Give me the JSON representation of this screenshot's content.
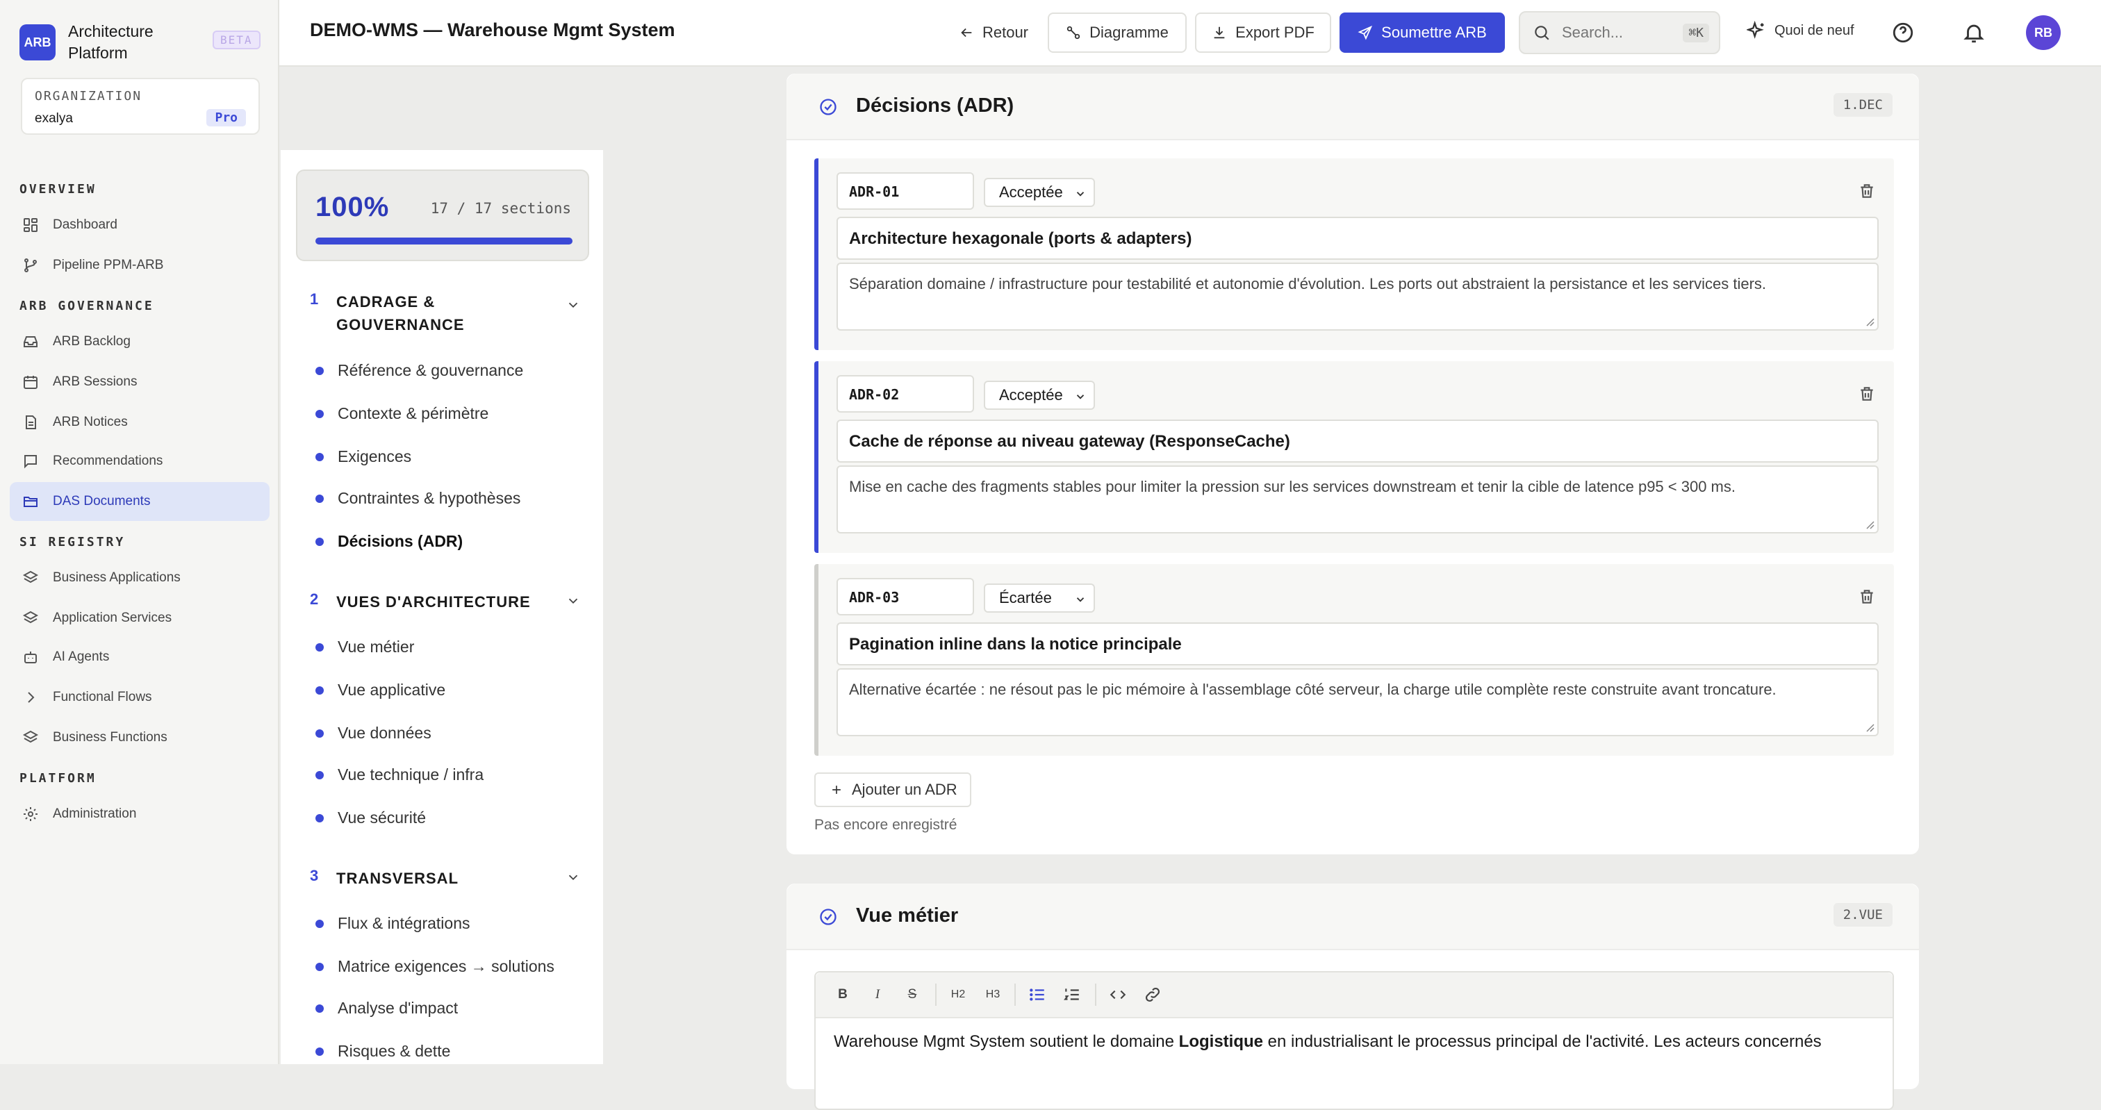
{
  "brand": {
    "logo": "ARB",
    "name": "Architecture Platform",
    "badge": "BETA"
  },
  "organization": {
    "label": "ORGANIZATION",
    "name": "exalya",
    "plan": "Pro"
  },
  "nav": {
    "overview_label": "OVERVIEW",
    "governance_label": "ARB GOVERNANCE",
    "registry_label": "SI REGISTRY",
    "platform_label": "PLATFORM",
    "items": [
      {
        "label": "Dashboard",
        "icon": "grid-icon"
      },
      {
        "label": "Pipeline PPM-ARB",
        "icon": "branch-icon"
      },
      {
        "label": "ARB Backlog",
        "icon": "inbox-icon"
      },
      {
        "label": "ARB Sessions",
        "icon": "calendar-icon"
      },
      {
        "label": "ARB Notices",
        "icon": "file-icon"
      },
      {
        "label": "Recommendations",
        "icon": "message-icon"
      },
      {
        "label": "DAS Documents",
        "icon": "folder-icon",
        "active": true
      },
      {
        "label": "Business Applications",
        "icon": "layers-icon"
      },
      {
        "label": "Application Services",
        "icon": "layers-icon"
      },
      {
        "label": "AI Agents",
        "icon": "bot-icon"
      },
      {
        "label": "Functional Flows",
        "icon": "chevron-right-icon"
      },
      {
        "label": "Business Functions",
        "icon": "layers-icon"
      },
      {
        "label": "Administration",
        "icon": "gear-icon"
      }
    ]
  },
  "header": {
    "title": "DEMO-WMS — Warehouse Mgmt System",
    "back": "Retour",
    "diagram": "Diagramme",
    "export": "Export PDF",
    "submit": "Soumettre ARB",
    "search_placeholder": "Search...",
    "search_shortcut": "⌘K",
    "whats_new": "Quoi de neuf",
    "avatar": "RB"
  },
  "toc": {
    "progress": "100%",
    "progress_value": 1.0,
    "progress_count": "17 / 17 sections",
    "groups": [
      {
        "num": "1",
        "title": "CADRAGE & GOUVERNANCE",
        "items": [
          "Référence & gouvernance",
          "Contexte & périmètre",
          "Exigences",
          "Contraintes & hypothèses",
          "Décisions (ADR)"
        ]
      },
      {
        "num": "2",
        "title": "VUES D'ARCHITECTURE",
        "items": [
          "Vue métier",
          "Vue applicative",
          "Vue données",
          "Vue technique / infra",
          "Vue sécurité"
        ]
      },
      {
        "num": "3",
        "title": "TRANSVERSAL",
        "items": [
          "Flux & intégrations",
          "Matrice exigences → solutions",
          "Analyse d'impact",
          "Risques & dette"
        ]
      }
    ],
    "current": "Décisions (ADR)"
  },
  "decisions": {
    "title": "Décisions (ADR)",
    "code": "1.DEC",
    "adrs": [
      {
        "id": "ADR-01",
        "status": "Acceptée",
        "title": "Architecture hexagonale (ports & adapters)",
        "description": "Séparation domaine / infrastructure pour testabilité et autonomie d'évolution. Les ports out abstraient la persistance et les services tiers."
      },
      {
        "id": "ADR-02",
        "status": "Acceptée",
        "title": "Cache de réponse au niveau gateway (ResponseCache)",
        "description": "Mise en cache des fragments stables pour limiter la pression sur les services downstream et tenir la cible de latence p95 < 300 ms."
      },
      {
        "id": "ADR-03",
        "status": "Écartée",
        "title": "Pagination inline dans la notice principale",
        "description": "Alternative écartée : ne résout pas le pic mémoire à l'assemblage côté serveur, la charge utile complète reste construite avant troncature."
      }
    ],
    "add_label": "Ajouter un ADR",
    "save_status": "Pas encore enregistré"
  },
  "business_view": {
    "title": "Vue métier",
    "code": "2.VUE",
    "toolbar": [
      "B",
      "I",
      "S",
      "H2",
      "H3",
      "bullet-list",
      "numbered-list",
      "code",
      "link"
    ],
    "text_before": "Warehouse Mgmt System soutient le domaine ",
    "text_bold": "Logistique",
    "text_after": " en industrialisant le processus principal de l'activité. Les acteurs concernés"
  },
  "colors": {
    "accent": "#3b49d6",
    "active_nav_bg": "#dfe5f8",
    "avatar": "#5b45d6"
  }
}
